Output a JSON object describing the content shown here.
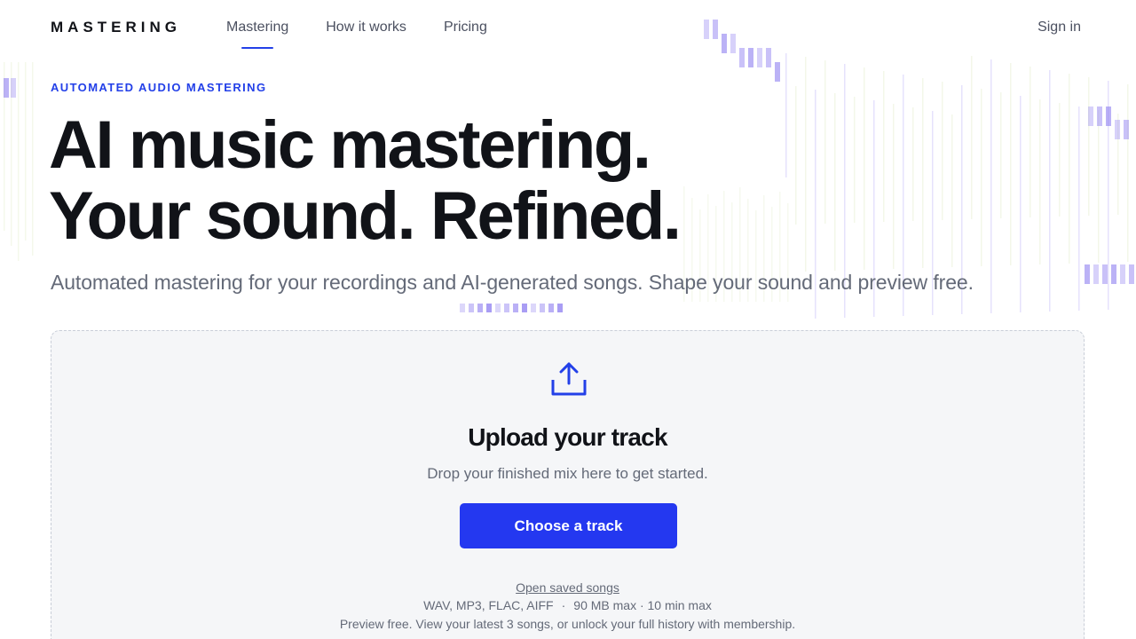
{
  "header": {
    "logo": "MASTERING",
    "nav": [
      {
        "label": "Mastering",
        "active": true
      },
      {
        "label": "How it works",
        "active": false
      },
      {
        "label": "Pricing",
        "active": false
      }
    ],
    "sign_in": "Sign in"
  },
  "hero": {
    "eyebrow": "AUTOMATED AUDIO MASTERING",
    "headline_line1": "AI music mastering.",
    "headline_line2": "Your sound. Refined.",
    "subhead": "Automated mastering for your recordings and AI-generated songs. Shape your sound and preview free."
  },
  "upload": {
    "icon": "upload-icon",
    "title": "Upload your track",
    "description": "Drop your finished mix here to get started.",
    "button": "Choose a track",
    "saved_link": "Open saved songs",
    "formats": "WAV, MP3, FLAC, AIFF",
    "limits": "90 MB max · 10 min max",
    "separator": "·",
    "note": "Preview free. View your latest 3 songs, or unlock your full history with membership."
  },
  "colors": {
    "accent": "#2340e8",
    "button": "#2438f0",
    "text": "#111318",
    "muted": "#646a78",
    "card_bg": "#f5f6f8",
    "decor_purple": "#8c7cf0",
    "decor_green": "#c7dc9a"
  }
}
